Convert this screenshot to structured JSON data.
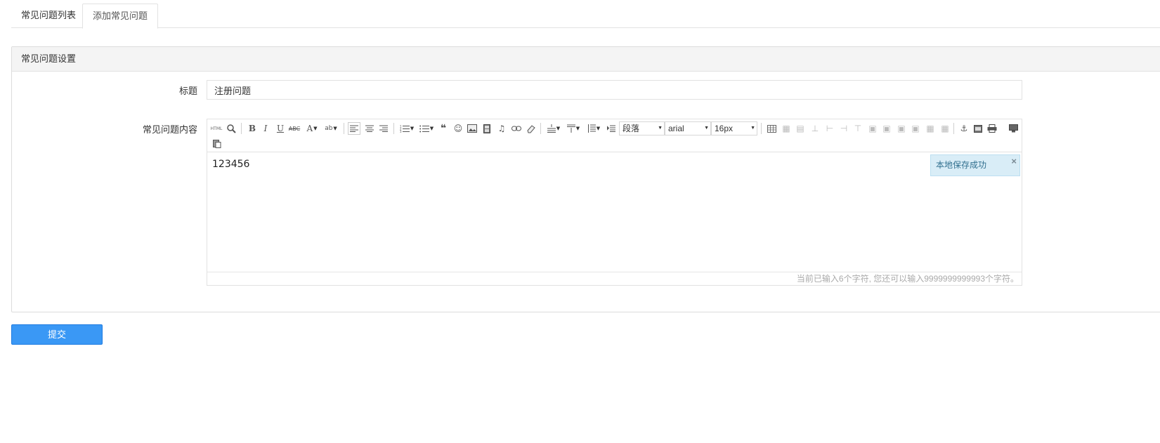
{
  "tabs": [
    {
      "label": "常见问题列表",
      "active": false
    },
    {
      "label": "添加常见问题",
      "active": true
    }
  ],
  "panel": {
    "title": "常见问题设置",
    "title_label": "标题",
    "title_value": "注册问题",
    "content_label": "常见问题内容"
  },
  "editor": {
    "toolbar": {
      "html_label": "HTML",
      "paragraph": "段落",
      "font": "arial",
      "size": "16px"
    },
    "content": "123456",
    "status": "当前已输入6个字符, 您还可以输入9999999999993个字符。",
    "toast": {
      "message": "本地保存成功",
      "close": "×"
    }
  },
  "submit_label": "提交",
  "colors": {
    "primary": "#3a98f5",
    "toast_bg": "#d9edf7",
    "toast_text": "#31708f"
  }
}
